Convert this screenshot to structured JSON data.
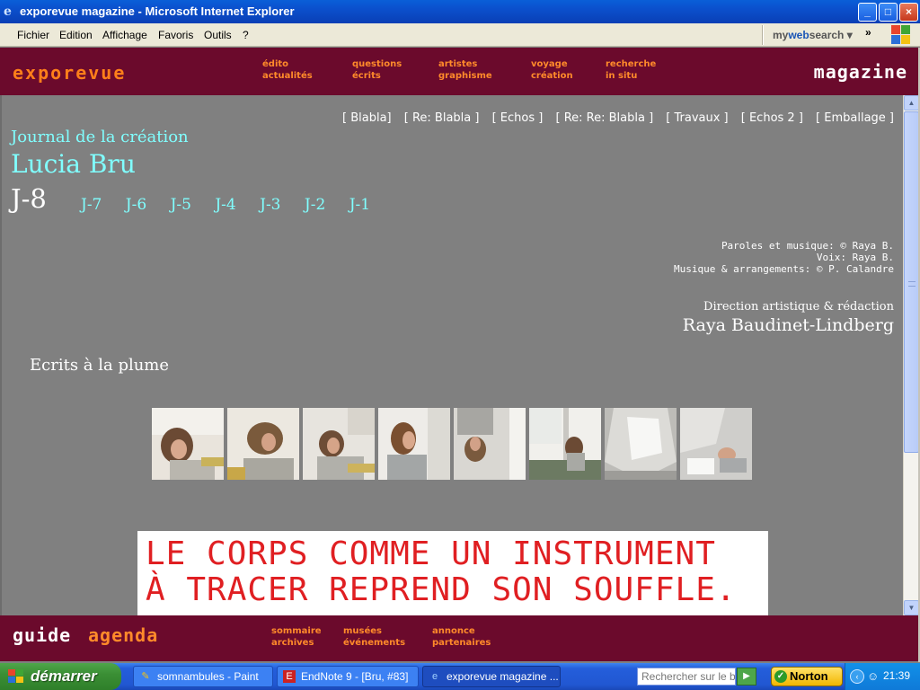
{
  "window": {
    "title": "exporevue magazine - Microsoft Internet Explorer",
    "buttons": {
      "minimize": "_",
      "maximize": "□",
      "close": "×"
    }
  },
  "menubar": {
    "items": [
      "Fichier",
      "Edition",
      "Affichage",
      "Favoris",
      "Outils",
      "?"
    ],
    "websearch_prefix": "my",
    "websearch_brand": "web",
    "websearch_suffix": "search",
    "websearch_caret": "▾",
    "chevron": "»"
  },
  "site_header": {
    "logo_left": "exporevue",
    "logo_right": "magazine",
    "nav": [
      [
        "édito",
        "actualités"
      ],
      [
        "questions",
        "écrits"
      ],
      [
        "artistes",
        "graphisme"
      ],
      [
        "voyage",
        "création"
      ],
      [
        "recherche",
        "in situ"
      ]
    ]
  },
  "top_links": [
    "[ Blabla]",
    "[ Re: Blabla ]",
    "[ Echos ]",
    "[ Re: Re: Blabla ]",
    "[ Travaux ]",
    "[ Echos 2 ]",
    "[ Emballage ]"
  ],
  "journal": {
    "title": "Journal de la création",
    "artist": "Lucia Bru",
    "current_day": "J-8",
    "days": [
      "J-7",
      "J-6",
      "J-5",
      "J-4",
      "J-3",
      "J-2",
      "J-1"
    ]
  },
  "credits": {
    "lines": [
      "Paroles et musique: © Raya B.",
      "Voix: Raya B.",
      "Musique & arrangements: © P. Calandre"
    ],
    "direction_label": "Direction artistique & rédaction",
    "director": "Raya Baudinet-Lindberg"
  },
  "section": {
    "title": "Ecrits à la plume"
  },
  "banner": {
    "line1": "LE CORPS COMME UN INSTRUMENT",
    "line2": "À TRACER REPREND SON SOUFFLE."
  },
  "scrollbar": {
    "up": "▲",
    "down": "▼"
  },
  "site_footer": {
    "logo_guide": "guide",
    "logo_agenda": "agenda",
    "nav": [
      [
        "sommaire",
        "archives"
      ],
      [
        "musées",
        "événements"
      ],
      [
        "annonce",
        "partenaires"
      ]
    ]
  },
  "taskbar": {
    "start_label": "démarrer",
    "tasks": [
      "somnambules - Paint",
      "EndNote 9 - [Bru, #83]",
      "exporevue magazine ..."
    ],
    "search_placeholder": "Rechercher sur le bur",
    "search_go": "▶",
    "norton_label": "Norton",
    "norton_check": "✓",
    "tray_arrow": "‹",
    "clock": "21:39"
  },
  "colors": {
    "site_bg": "#808080",
    "header_bg": "#6b0a2c",
    "accent_orange": "#ff8a2a",
    "journal_cyan": "#80ffff",
    "banner_text_red": "#e01f22"
  }
}
